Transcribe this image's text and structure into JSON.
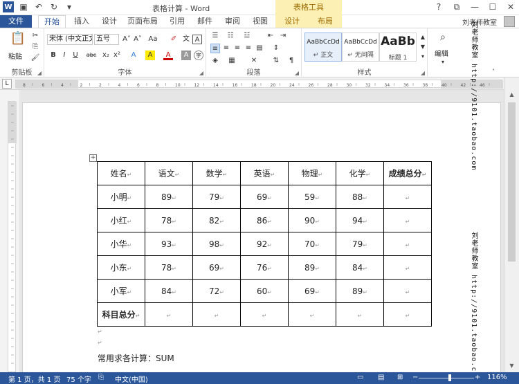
{
  "titlebar": {
    "logo": "W",
    "title": "表格计算 - Word",
    "tools_label": "表格工具",
    "buttons": [
      "?",
      "⧉",
      "—",
      "☐",
      "✕"
    ]
  },
  "tabs": {
    "file": "文件",
    "items": [
      "开始",
      "插入",
      "设计",
      "页面布局",
      "引用",
      "邮件",
      "审阅",
      "视图"
    ],
    "tool_items": [
      "设计",
      "布局"
    ],
    "user": "刘老师教室"
  },
  "ribbon": {
    "clipboard": {
      "paste": "粘贴",
      "label": "剪贴板"
    },
    "font": {
      "font_name": "宋体 (中文正文)",
      "font_size": "五号",
      "label": "字体",
      "buttons": [
        "B",
        "I",
        "U",
        "abc",
        "x₂",
        "x²",
        "A",
        "A",
        "A",
        "A"
      ],
      "top_buttons": [
        "A˄",
        "A˅",
        "Aa",
        "✐",
        "文",
        "A"
      ]
    },
    "paragraph": {
      "label": "段落"
    },
    "styles": {
      "label": "样式",
      "items": [
        {
          "sample": "AaBbCcDd",
          "name": "↵ 正文"
        },
        {
          "sample": "AaBbCcDd",
          "name": "↵ 无间隔"
        },
        {
          "sample": "AaBb",
          "name": "标题 1"
        }
      ]
    },
    "editing": {
      "label": "编辑"
    }
  },
  "ruler": {
    "corner": "L",
    "marks": [
      "8",
      "6",
      "4",
      "2",
      "2",
      "4",
      "6",
      "8",
      "10",
      "12",
      "14",
      "16",
      "18",
      "20",
      "24",
      "26",
      "28",
      "30",
      "32",
      "34",
      "36",
      "38",
      "40",
      "42",
      "46"
    ]
  },
  "table": {
    "headers": [
      "姓名",
      "语文",
      "数学",
      "英语",
      "物理",
      "化学",
      "成绩总分"
    ],
    "rows": [
      [
        "小明",
        "89",
        "79",
        "69",
        "59",
        "88",
        ""
      ],
      [
        "小红",
        "78",
        "82",
        "86",
        "90",
        "94",
        ""
      ],
      [
        "小华",
        "93",
        "98",
        "92",
        "70",
        "79",
        ""
      ],
      [
        "小东",
        "78",
        "69",
        "76",
        "89",
        "84",
        ""
      ],
      [
        "小军",
        "84",
        "72",
        "60",
        "69",
        "89",
        ""
      ],
      [
        "科目总分",
        "",
        "",
        "",
        "",
        "",
        ""
      ]
    ]
  },
  "document": {
    "sum_text": "常用求各计算：SUM"
  },
  "watermark": {
    "text": "刘老师教室 http://9101.taobao.com"
  },
  "status": {
    "page": "第 1 页，共 1 页",
    "words": "75 个字",
    "language": "中文(中国)",
    "zoom": "116%",
    "zoom_minus": "−",
    "zoom_plus": "+"
  },
  "colors": {
    "accent": "#2b579a",
    "tool_tab": "#fdf0b4"
  }
}
